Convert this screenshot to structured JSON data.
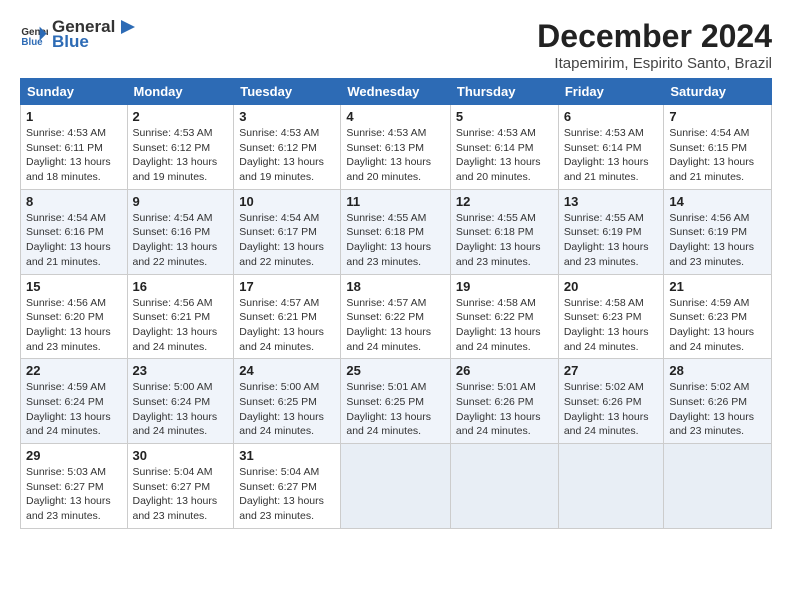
{
  "logo": {
    "general": "General",
    "blue": "Blue"
  },
  "title": "December 2024",
  "subtitle": "Itapemirim, Espirito Santo, Brazil",
  "headers": [
    "Sunday",
    "Monday",
    "Tuesday",
    "Wednesday",
    "Thursday",
    "Friday",
    "Saturday"
  ],
  "weeks": [
    [
      {
        "day": "1",
        "info": "Sunrise: 4:53 AM\nSunset: 6:11 PM\nDaylight: 13 hours\nand 18 minutes."
      },
      {
        "day": "2",
        "info": "Sunrise: 4:53 AM\nSunset: 6:12 PM\nDaylight: 13 hours\nand 19 minutes."
      },
      {
        "day": "3",
        "info": "Sunrise: 4:53 AM\nSunset: 6:12 PM\nDaylight: 13 hours\nand 19 minutes."
      },
      {
        "day": "4",
        "info": "Sunrise: 4:53 AM\nSunset: 6:13 PM\nDaylight: 13 hours\nand 20 minutes."
      },
      {
        "day": "5",
        "info": "Sunrise: 4:53 AM\nSunset: 6:14 PM\nDaylight: 13 hours\nand 20 minutes."
      },
      {
        "day": "6",
        "info": "Sunrise: 4:53 AM\nSunset: 6:14 PM\nDaylight: 13 hours\nand 21 minutes."
      },
      {
        "day": "7",
        "info": "Sunrise: 4:54 AM\nSunset: 6:15 PM\nDaylight: 13 hours\nand 21 minutes."
      }
    ],
    [
      {
        "day": "8",
        "info": "Sunrise: 4:54 AM\nSunset: 6:16 PM\nDaylight: 13 hours\nand 21 minutes."
      },
      {
        "day": "9",
        "info": "Sunrise: 4:54 AM\nSunset: 6:16 PM\nDaylight: 13 hours\nand 22 minutes."
      },
      {
        "day": "10",
        "info": "Sunrise: 4:54 AM\nSunset: 6:17 PM\nDaylight: 13 hours\nand 22 minutes."
      },
      {
        "day": "11",
        "info": "Sunrise: 4:55 AM\nSunset: 6:18 PM\nDaylight: 13 hours\nand 23 minutes."
      },
      {
        "day": "12",
        "info": "Sunrise: 4:55 AM\nSunset: 6:18 PM\nDaylight: 13 hours\nand 23 minutes."
      },
      {
        "day": "13",
        "info": "Sunrise: 4:55 AM\nSunset: 6:19 PM\nDaylight: 13 hours\nand 23 minutes."
      },
      {
        "day": "14",
        "info": "Sunrise: 4:56 AM\nSunset: 6:19 PM\nDaylight: 13 hours\nand 23 minutes."
      }
    ],
    [
      {
        "day": "15",
        "info": "Sunrise: 4:56 AM\nSunset: 6:20 PM\nDaylight: 13 hours\nand 23 minutes."
      },
      {
        "day": "16",
        "info": "Sunrise: 4:56 AM\nSunset: 6:21 PM\nDaylight: 13 hours\nand 24 minutes."
      },
      {
        "day": "17",
        "info": "Sunrise: 4:57 AM\nSunset: 6:21 PM\nDaylight: 13 hours\nand 24 minutes."
      },
      {
        "day": "18",
        "info": "Sunrise: 4:57 AM\nSunset: 6:22 PM\nDaylight: 13 hours\nand 24 minutes."
      },
      {
        "day": "19",
        "info": "Sunrise: 4:58 AM\nSunset: 6:22 PM\nDaylight: 13 hours\nand 24 minutes."
      },
      {
        "day": "20",
        "info": "Sunrise: 4:58 AM\nSunset: 6:23 PM\nDaylight: 13 hours\nand 24 minutes."
      },
      {
        "day": "21",
        "info": "Sunrise: 4:59 AM\nSunset: 6:23 PM\nDaylight: 13 hours\nand 24 minutes."
      }
    ],
    [
      {
        "day": "22",
        "info": "Sunrise: 4:59 AM\nSunset: 6:24 PM\nDaylight: 13 hours\nand 24 minutes."
      },
      {
        "day": "23",
        "info": "Sunrise: 5:00 AM\nSunset: 6:24 PM\nDaylight: 13 hours\nand 24 minutes."
      },
      {
        "day": "24",
        "info": "Sunrise: 5:00 AM\nSunset: 6:25 PM\nDaylight: 13 hours\nand 24 minutes."
      },
      {
        "day": "25",
        "info": "Sunrise: 5:01 AM\nSunset: 6:25 PM\nDaylight: 13 hours\nand 24 minutes."
      },
      {
        "day": "26",
        "info": "Sunrise: 5:01 AM\nSunset: 6:26 PM\nDaylight: 13 hours\nand 24 minutes."
      },
      {
        "day": "27",
        "info": "Sunrise: 5:02 AM\nSunset: 6:26 PM\nDaylight: 13 hours\nand 24 minutes."
      },
      {
        "day": "28",
        "info": "Sunrise: 5:02 AM\nSunset: 6:26 PM\nDaylight: 13 hours\nand 23 minutes."
      }
    ],
    [
      {
        "day": "29",
        "info": "Sunrise: 5:03 AM\nSunset: 6:27 PM\nDaylight: 13 hours\nand 23 minutes."
      },
      {
        "day": "30",
        "info": "Sunrise: 5:04 AM\nSunset: 6:27 PM\nDaylight: 13 hours\nand 23 minutes."
      },
      {
        "day": "31",
        "info": "Sunrise: 5:04 AM\nSunset: 6:27 PM\nDaylight: 13 hours\nand 23 minutes."
      },
      {
        "day": "",
        "info": ""
      },
      {
        "day": "",
        "info": ""
      },
      {
        "day": "",
        "info": ""
      },
      {
        "day": "",
        "info": ""
      }
    ]
  ]
}
